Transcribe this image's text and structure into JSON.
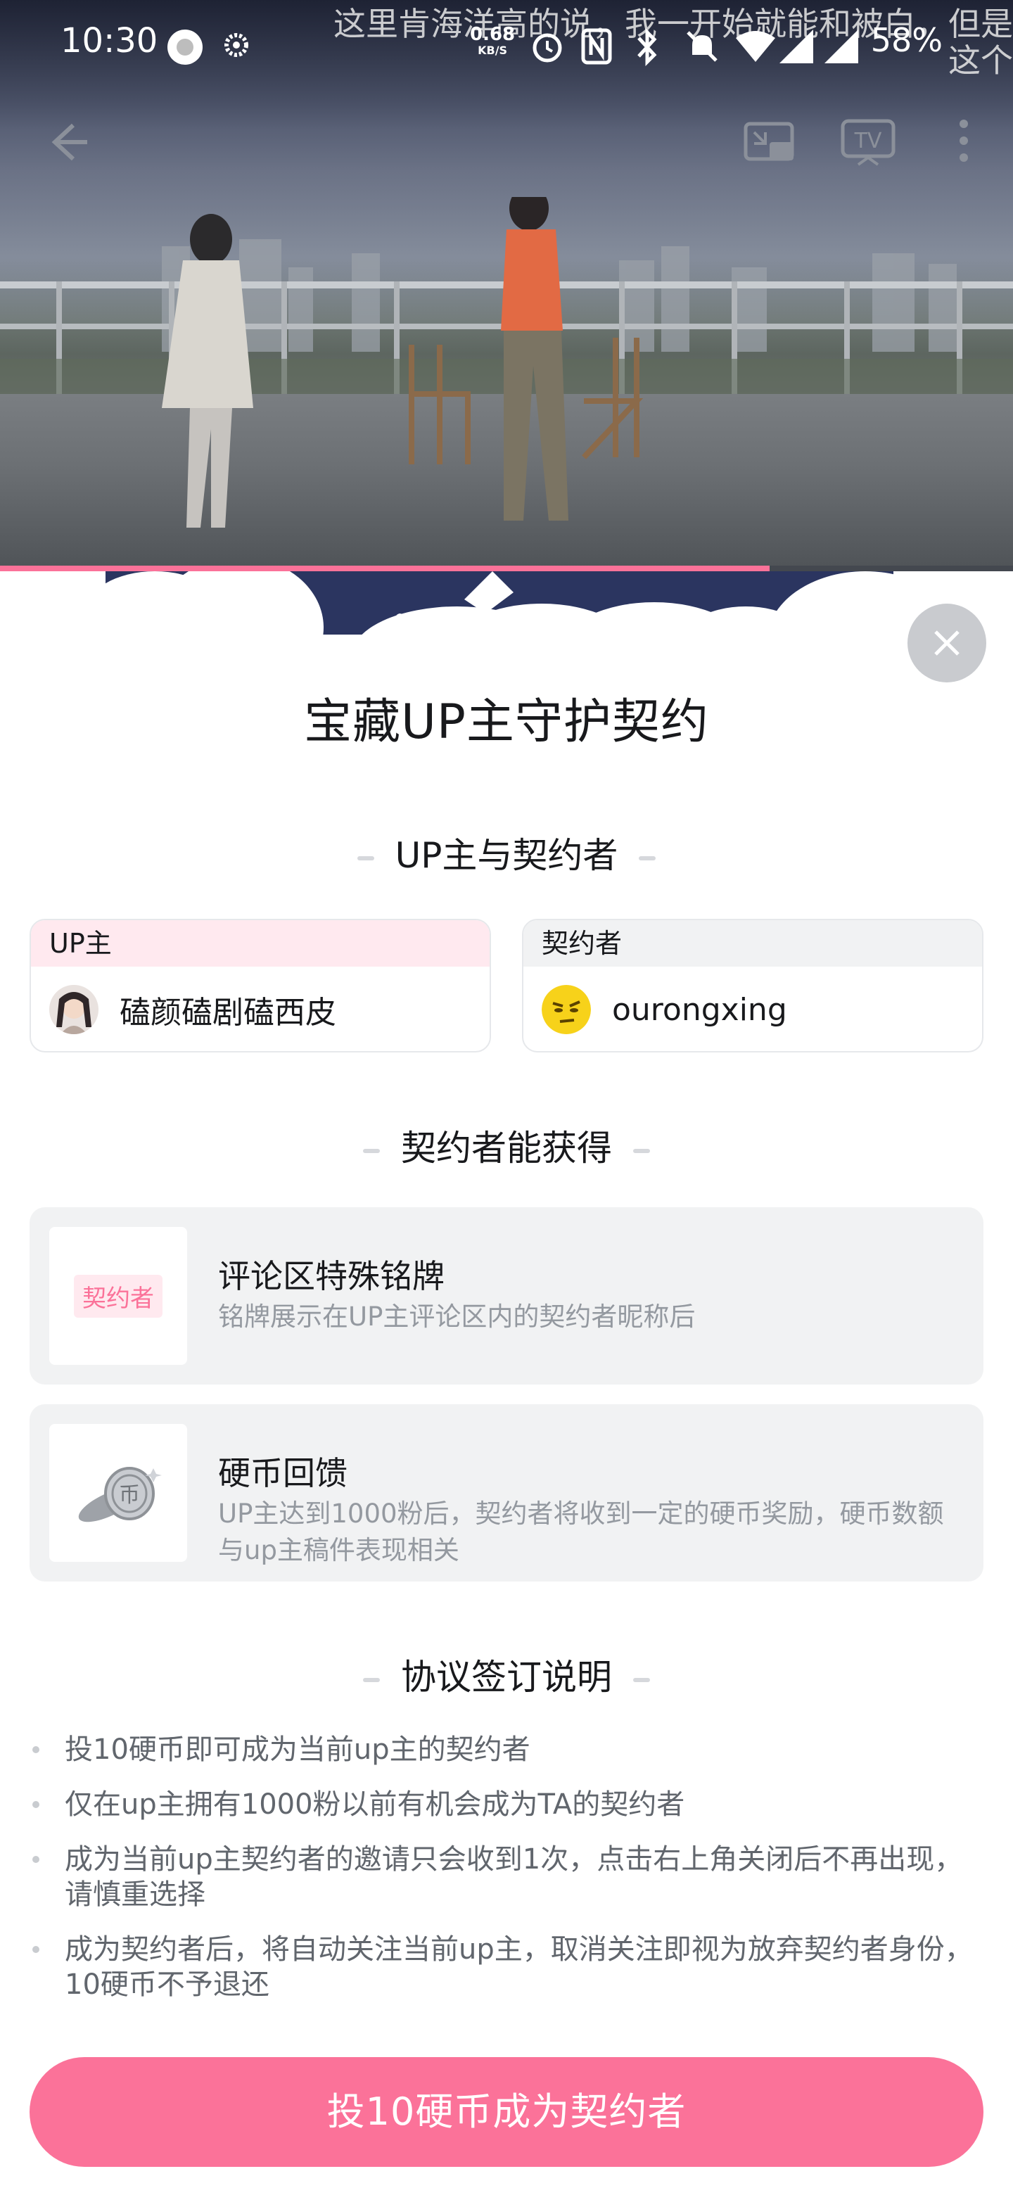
{
  "status_bar": {
    "time": "10:30",
    "net_speed_value": "0.68",
    "net_speed_unit": "KB/S",
    "battery": "58%"
  },
  "video": {
    "subtitle_line1": "这里肯海洋高的说，我一开始就能和被白，但是",
    "subtitle_line2": "这个",
    "progress_fraction": 0.76
  },
  "sheet": {
    "title": "宝藏UP主守护契约",
    "section_parties": "UP主与契约者",
    "up_card": {
      "label": "UP主",
      "name": "磕颜磕剧磕西皮"
    },
    "contractor_card": {
      "label": "契约者",
      "name": "ourongxing"
    },
    "section_benefits": "契约者能获得",
    "benefits": [
      {
        "badge": "契约者",
        "title": "评论区特殊铭牌",
        "desc": "铭牌展示在UP主评论区内的契约者昵称后"
      },
      {
        "title": "硬币回馈",
        "desc": "UP主达到1000粉后，契约者将收到一定的硬币奖励，硬币数额与up主稿件表现相关"
      }
    ],
    "section_rules": "协议签订说明",
    "rules": [
      "投10硬币即可成为当前up主的契约者",
      "仅在up主拥有1000粉以前有机会成为TA的契约者",
      "成为当前up主契约者的邀请只会收到1次，点击右上角关闭后不再出现，请慎重选择",
      "成为契约者后，将自动关注当前up主，取消关注即视为放弃契约者身份，10硬币不予退还"
    ],
    "cta": "投10硬币成为契约者"
  },
  "colors": {
    "accent": "#fb7299",
    "banner_navy": "#2b3560",
    "muted_text": "#9499a0"
  },
  "icons": [
    "back-arrow-icon",
    "pip-icon",
    "tv-cast-icon",
    "more-vertical-icon",
    "close-icon",
    "coin-icon",
    "alarm-icon",
    "nfc-icon",
    "bluetooth-icon",
    "mute-icon",
    "wifi-icon",
    "signal-icon"
  ]
}
